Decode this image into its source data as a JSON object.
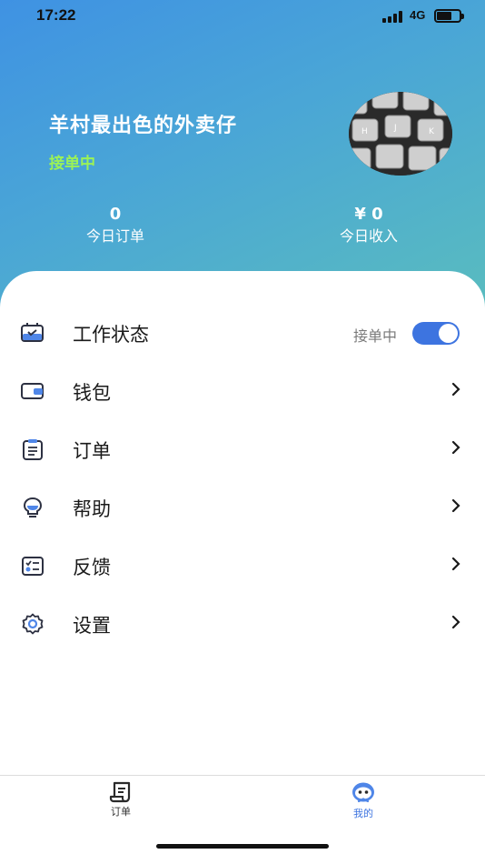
{
  "status_bar": {
    "time": "17:22",
    "network": "4G"
  },
  "profile": {
    "name": "羊村最出色的外卖仔",
    "status": "接单中",
    "avatar_icon": "keyboard-photo-avatar"
  },
  "stats": [
    {
      "value": "0",
      "label": "今日订单"
    },
    {
      "value": "¥ 0",
      "label": "今日收入"
    }
  ],
  "menu": {
    "work_status": {
      "label": "工作状态",
      "toggle_text": "接单中",
      "toggle_on": true,
      "icon": "work-status-icon"
    },
    "wallet": {
      "label": "钱包",
      "icon": "wallet-icon"
    },
    "orders": {
      "label": "订单",
      "icon": "clipboard-icon"
    },
    "help": {
      "label": "帮助",
      "icon": "lightbulb-icon"
    },
    "feedback": {
      "label": "反馈",
      "icon": "checklist-icon"
    },
    "settings": {
      "label": "设置",
      "icon": "gear-icon"
    }
  },
  "tabbar": {
    "orders_label": "订单",
    "mine_label": "我的"
  },
  "colors": {
    "accent": "#3d74e0",
    "status_green": "#9bf257",
    "header_gradient_start": "#3f92e3",
    "header_gradient_end": "#59bcbf"
  }
}
